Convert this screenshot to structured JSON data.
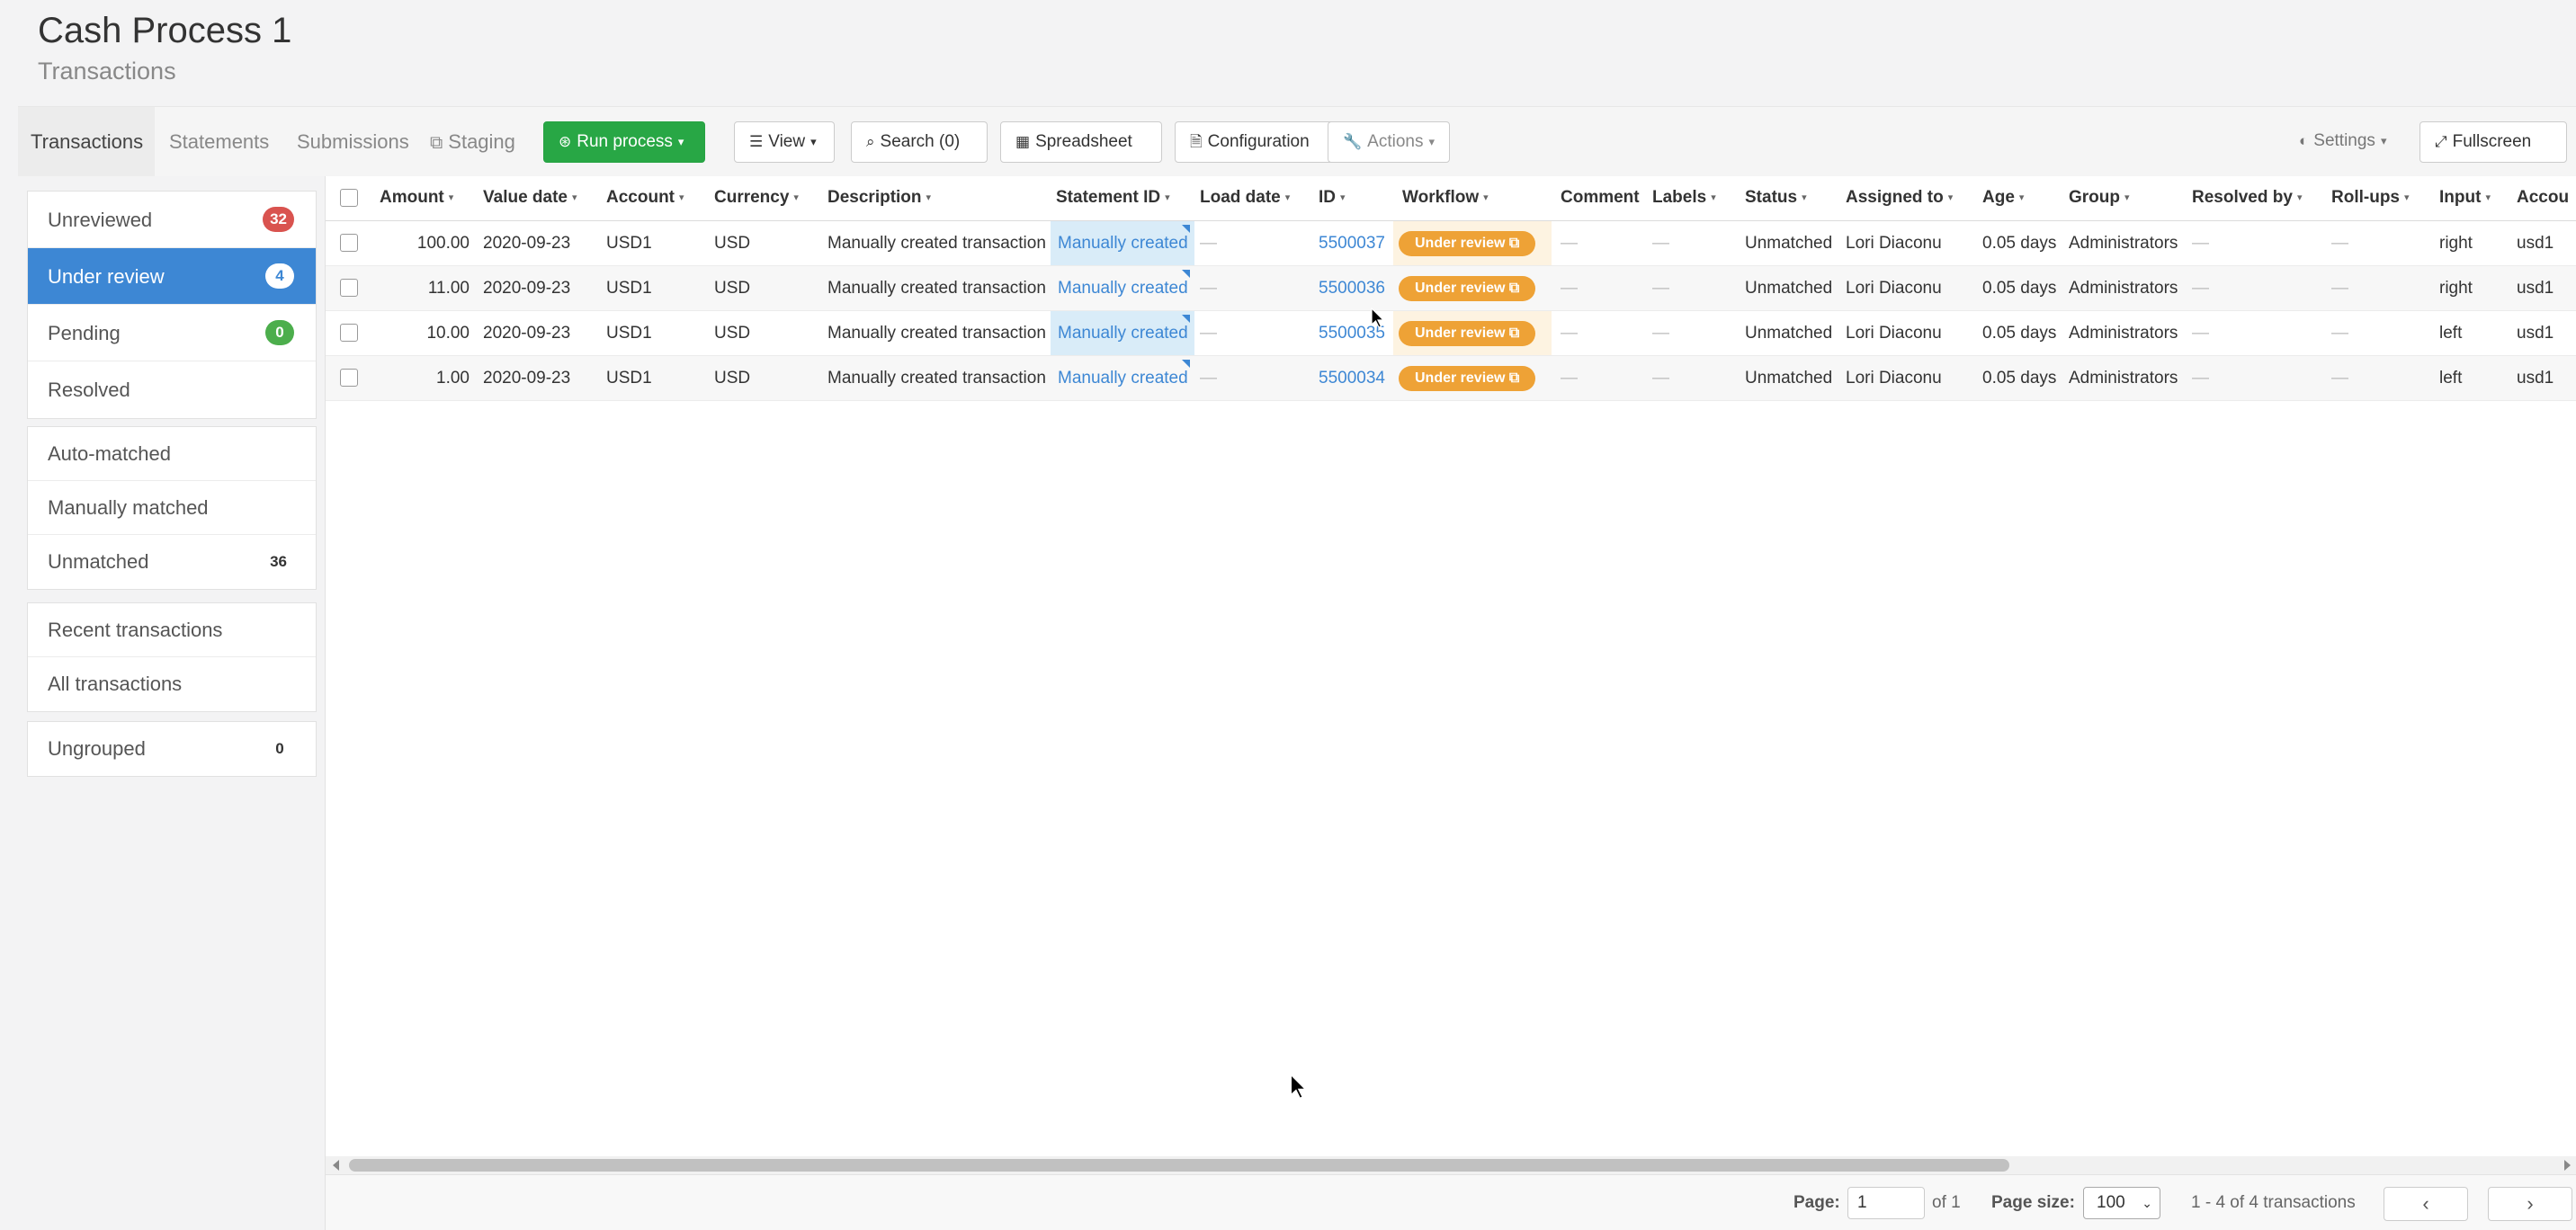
{
  "header": {
    "title": "Cash Process 1",
    "subtitle": "Transactions"
  },
  "tabs": [
    "Transactions",
    "Statements",
    "Submissions",
    "Staging"
  ],
  "toolbar": {
    "run_process": "Run process",
    "view": "View",
    "search": "Search (0)",
    "spreadsheet": "Spreadsheet",
    "configuration": "Configuration",
    "actions": "Actions",
    "settings": "Settings",
    "fullscreen": "Fullscreen"
  },
  "sidebar": {
    "status_items": [
      {
        "label": "Unreviewed",
        "count": "32"
      },
      {
        "label": "Under review",
        "count": "4"
      },
      {
        "label": "Pending",
        "count": "0"
      },
      {
        "label": "Resolved",
        "count": ""
      }
    ],
    "match_items": [
      {
        "label": "Auto-matched",
        "count": ""
      },
      {
        "label": "Manually matched",
        "count": ""
      },
      {
        "label": "Unmatched",
        "count": "36"
      }
    ],
    "list_items": [
      {
        "label": "Recent transactions"
      },
      {
        "label": "All transactions"
      }
    ],
    "group_items": [
      {
        "label": "Ungrouped",
        "count": "0"
      }
    ]
  },
  "table": {
    "columns": [
      "Amount",
      "Value date",
      "Account",
      "Currency",
      "Description",
      "Statement ID",
      "Load date",
      "ID",
      "Workflow",
      "Comment",
      "Labels",
      "Status",
      "Assigned to",
      "Age",
      "Group",
      "Resolved by",
      "Roll-ups",
      "Input",
      "Accou"
    ],
    "rows": [
      {
        "amount": "100.00",
        "value_date": "2020-09-23",
        "account": "USD1",
        "currency": "USD",
        "description": "Manually created transaction",
        "statement_id": "Manually created",
        "load_date": "—",
        "id": "5500037",
        "workflow": "Under review",
        "comment": "—",
        "labels": "—",
        "status": "Unmatched",
        "assigned_to": "Lori Diaconu",
        "age": "0.05 days",
        "group": "Administrators",
        "resolved_by": "—",
        "rollups": "—",
        "input": "right",
        "account_ref": "usd1"
      },
      {
        "amount": "11.00",
        "value_date": "2020-09-23",
        "account": "USD1",
        "currency": "USD",
        "description": "Manually created transaction",
        "statement_id": "Manually created",
        "load_date": "—",
        "id": "5500036",
        "workflow": "Under review",
        "comment": "—",
        "labels": "—",
        "status": "Unmatched",
        "assigned_to": "Lori Diaconu",
        "age": "0.05 days",
        "group": "Administrators",
        "resolved_by": "—",
        "rollups": "—",
        "input": "right",
        "account_ref": "usd1"
      },
      {
        "amount": "10.00",
        "value_date": "2020-09-23",
        "account": "USD1",
        "currency": "USD",
        "description": "Manually created transaction",
        "statement_id": "Manually created",
        "load_date": "—",
        "id": "5500035",
        "workflow": "Under review",
        "comment": "—",
        "labels": "—",
        "status": "Unmatched",
        "assigned_to": "Lori Diaconu",
        "age": "0.05 days",
        "group": "Administrators",
        "resolved_by": "—",
        "rollups": "—",
        "input": "left",
        "account_ref": "usd1"
      },
      {
        "amount": "1.00",
        "value_date": "2020-09-23",
        "account": "USD1",
        "currency": "USD",
        "description": "Manually created transaction",
        "statement_id": "Manually created",
        "load_date": "—",
        "id": "5500034",
        "workflow": "Under review",
        "comment": "—",
        "labels": "—",
        "status": "Unmatched",
        "assigned_to": "Lori Diaconu",
        "age": "0.05 days",
        "group": "Administrators",
        "resolved_by": "—",
        "rollups": "—",
        "input": "left",
        "account_ref": "usd1"
      }
    ]
  },
  "footer": {
    "page_label": "Page:",
    "page_value": "1",
    "of_label": "of 1",
    "page_size_label": "Page size:",
    "page_size_value": "100",
    "summary": "1 - 4 of 4 transactions"
  },
  "colors": {
    "accent": "#3d87d4",
    "run": "#28a745",
    "workflow": "#eea236",
    "unreviewed": "#d9534f"
  }
}
